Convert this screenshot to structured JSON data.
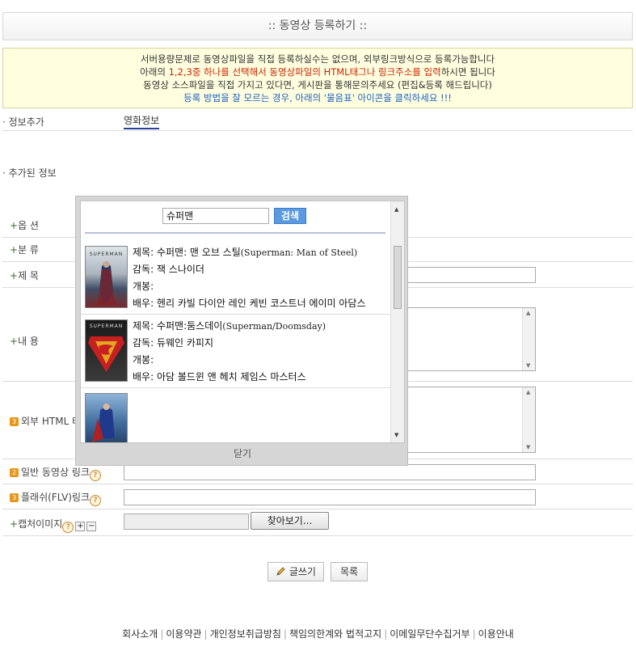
{
  "title": ":: 동영상 등록하기 ::",
  "notice": {
    "line1": "서버용량문제로 동영상파일을 직접 등록하실수는 없으며, 외부링크방식으로 등록가능합니다",
    "line2_pre": "아래의 ",
    "line2_red": "1,2,3중 하나를 선택해서 동영상파일의 HTML태그나 링크주소를 입력",
    "line2_post": "하시면 됩니다",
    "line3": "동영상 소스파일을 직접 가지고 있다면, 게시판을 통해문의주세요 (편집&등록 해드립니다)",
    "line4": "등록 방법을 잘 모르는 경우, 아래의 '물음표' 아이콘을 클릭하세요 !!!"
  },
  "form": {
    "info_add_label": "· 정보추가",
    "movie_tab": "영화정보",
    "added_info_label": "· 추가된 정보",
    "option_label": "옵 션",
    "category_label": "분 류",
    "subject_label": "제 목",
    "content_label": "내 용",
    "external_html_label": "외부 HTML 태",
    "video_link_label": "일반 동영상 링크",
    "flash_link_label": "플래쉬(FLV)링크",
    "capture_label": "캡처이미지",
    "plus": "+",
    "badge3": "3",
    "badge2": "2",
    "help": "?",
    "mini_plus": "+",
    "mini_minus": "−",
    "browse_label": "찾아보기...",
    "write_label": "글쓰기",
    "list_label": "목록"
  },
  "popup": {
    "search_value": "슈퍼맨",
    "search_button": "검색",
    "close_label": "닫기",
    "results": [
      {
        "title_label": "제목: ",
        "title": "수퍼맨: 맨 오브 스틸",
        "title_en": "(Superman: Man of Steel)",
        "director_label": "감독: ",
        "director": "잭 스나이더",
        "release_label": "개봉:",
        "actors_label": "배우: ",
        "actors": "헨리 카빌 다이안 레인 케빈 코스트너 에이미 아담스",
        "poster_text": "SUPERMAN"
      },
      {
        "title_label": "제목: ",
        "title": "수퍼맨:둠스데이",
        "title_en": "(Superman/Doomsday)",
        "director_label": "감독: ",
        "director": "듀웨인 카피지",
        "release_label": "개봉:",
        "actors_label": "배우: ",
        "actors": "아담 볼드윈 앤 헤치 제임스 마스터스",
        "poster_text": "SUPERMAN"
      }
    ]
  },
  "footer": {
    "links": [
      "회사소개",
      "이용약관",
      "개인정보취급방침",
      "책임의한계와 법적고지",
      "이메일무단수집거부",
      "이용안내"
    ],
    "separator": "|"
  }
}
